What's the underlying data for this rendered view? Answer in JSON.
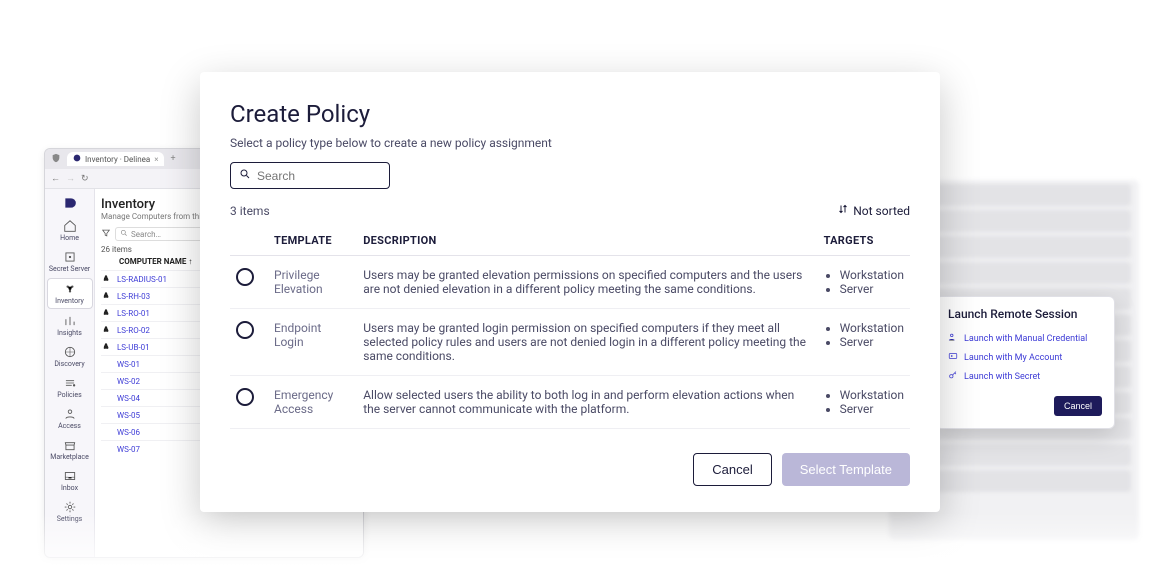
{
  "browser": {
    "tab_title": "Inventory · Delinea",
    "url_fragment": "https:/",
    "nav": [
      {
        "label": "Home"
      },
      {
        "label": "Secret Server"
      },
      {
        "label": "Inventory"
      },
      {
        "label": "Insights"
      },
      {
        "label": "Discovery"
      },
      {
        "label": "Policies"
      },
      {
        "label": "Access"
      },
      {
        "label": "Marketplace"
      },
      {
        "label": "Inbox"
      },
      {
        "label": "Settings"
      }
    ],
    "page_title": "Inventory",
    "page_sub": "Manage Computers from this cent",
    "search_placeholder": "Search…",
    "count": "26 items",
    "col_header": "COMPUTER NAME",
    "rows": [
      {
        "os": "linux",
        "name": "LS-RADIUS-01"
      },
      {
        "os": "linux",
        "name": "LS-RH-03"
      },
      {
        "os": "linux",
        "name": "LS-RO-01"
      },
      {
        "os": "linux",
        "name": "LS-RO-02"
      },
      {
        "os": "linux",
        "name": "LS-UB-01"
      },
      {
        "os": "win",
        "name": "WS-01"
      },
      {
        "os": "win",
        "name": "WS-02"
      },
      {
        "os": "win",
        "name": "WS-04"
      },
      {
        "os": "win",
        "name": "WS-05"
      },
      {
        "os": "win",
        "name": "WS-06"
      },
      {
        "os": "win",
        "name": "WS-07"
      }
    ]
  },
  "launch": {
    "title": "Launch Remote Session",
    "options": [
      "Launch with Manual Credential",
      "Launch with My Account",
      "Launch with Secret"
    ],
    "cancel": "Cancel"
  },
  "modal": {
    "title": "Create Policy",
    "subtitle": "Select a policy type below to create a new policy assignment",
    "search_placeholder": "Search",
    "items_count": "3 items",
    "sort_label": "Not sorted",
    "columns": {
      "template": "TEMPLATE",
      "description": "DESCRIPTION",
      "targets": "TARGETS"
    },
    "rows": [
      {
        "template": "Privilege Elevation",
        "description": "Users may be granted elevation permissions on specified computers and the users are not denied elevation in a different policy meeting the same conditions.",
        "targets": [
          "Workstation",
          "Server"
        ]
      },
      {
        "template": "Endpoint Login",
        "description": "Users may be granted login permission on specified computers if they meet all selected policy rules and users are not denied login in a different policy meeting the same conditions.",
        "targets": [
          "Workstation",
          "Server"
        ]
      },
      {
        "template": "Emergency Access",
        "description": "Allow selected users the ability to both log in and perform elevation actions when the server cannot communicate with the platform.",
        "targets": [
          "Workstation",
          "Server"
        ]
      }
    ],
    "cancel": "Cancel",
    "select": "Select Template"
  }
}
